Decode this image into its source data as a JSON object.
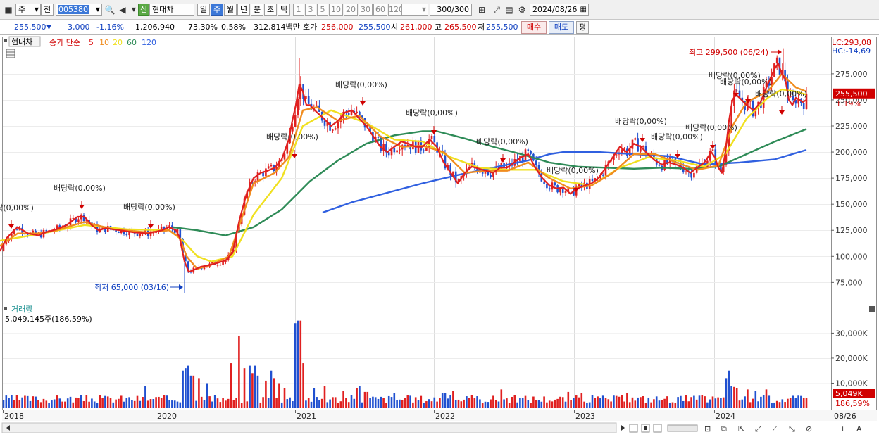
{
  "toolbar": {
    "period_type": "주",
    "market": "전",
    "code": "005380",
    "badge": "신",
    "name": "현대차",
    "periods": [
      "일",
      "주",
      "월",
      "년",
      "분",
      "초",
      "틱"
    ],
    "selected_period": "주",
    "intervals": [
      "1",
      "3",
      "5",
      "10",
      "20",
      "30",
      "60",
      "120"
    ],
    "count": "300",
    "count_total": "/300",
    "date": "2024/08/26"
  },
  "quote": {
    "price": "255,500",
    "change": "3,000",
    "change_pct": "-1.16%",
    "volume": "1,206,940",
    "ratio": "73.30%",
    "turnover": "0.58%",
    "amount": "312,814백만",
    "hoga_label": "호가",
    "ask": "256,000",
    "bid": "255,500",
    "open_label": "시",
    "open": "261,000",
    "high_label": "고",
    "high": "265,500",
    "low_label": "저",
    "low": "255,500",
    "buy": "매수",
    "sell": "매도",
    "eval": "평"
  },
  "colors": {
    "ma5": "#e02020",
    "ma10": "#f08c1e",
    "ma20": "#f0e020",
    "ma60": "#2e8b57",
    "ma120": "#3060e0",
    "up": "#e02020",
    "down": "#2050d0"
  },
  "chart_data": {
    "type": "line",
    "title": "현대차",
    "legend": {
      "label": "종가 단순",
      "periods": [
        "5",
        "10",
        "20",
        "60",
        "120"
      ]
    },
    "y_ticks": [
      "275,000",
      "250,000",
      "225,000",
      "200,000",
      "175,000",
      "150,000",
      "125,000",
      "100,000",
      "75,000"
    ],
    "ylim": [
      55000,
      310000
    ],
    "x_labels": [
      "2018",
      "2020",
      "2021",
      "2022",
      "2023",
      "2024",
      "08/26"
    ],
    "lc_label": "LC:293,08",
    "hc_label": "HC:-14,69",
    "last_price_label": "255,500",
    "last_pct_label": "1.19%",
    "high_annotation": "최고 299,500 (06/24)",
    "low_annotation": "최저 65,000 (03/16)",
    "dividend_label": "배당락(0,00%)",
    "series": [
      {
        "name": "5",
        "x": [
          0,
          10,
          20,
          25,
          40,
          55,
          60,
          70,
          80,
          95,
          110,
          120,
          130,
          140,
          150,
          170,
          190,
          210,
          230,
          240,
          250,
          255,
          258,
          262,
          268,
          275,
          285,
          300,
          320,
          330,
          340,
          350,
          360,
          370,
          380,
          390,
          400,
          410,
          415,
          420,
          425,
          430,
          435,
          440,
          450,
          460,
          470,
          480,
          490,
          500,
          510,
          520,
          530,
          540,
          550,
          560,
          570,
          580,
          590,
          600,
          610,
          620,
          630,
          640,
          650,
          660,
          670,
          680,
          690,
          700,
          710,
          720,
          730,
          740,
          750,
          760,
          770,
          780,
          790,
          800,
          810,
          815,
          820,
          830,
          840,
          850,
          860,
          870,
          880,
          890,
          900,
          910,
          920,
          930,
          940,
          950,
          960,
          970,
          980,
          990,
          1000,
          1010,
          1015,
          1020,
          1025,
          1030,
          1035,
          1040,
          1045,
          1050,
          1060,
          1070,
          1080,
          1090,
          1100,
          1105,
          1110,
          1115,
          1120,
          1125,
          1130,
          1135,
          1140,
          1145
        ],
        "values": [
          105000,
          118000,
          125000,
          128000,
          122000,
          120000,
          122000,
          124000,
          126000,
          130000,
          138000,
          138000,
          130000,
          125000,
          127000,
          125000,
          123000,
          122000,
          125000,
          128000,
          125000,
          118000,
          108000,
          95000,
          85000,
          87000,
          90000,
          92000,
          96000,
          103000,
          135000,
          160000,
          175000,
          180000,
          182000,
          185000,
          193000,
          212000,
          230000,
          245000,
          265000,
          258000,
          245000,
          245000,
          238000,
          232000,
          225000,
          230000,
          238000,
          240000,
          232000,
          225000,
          215000,
          205000,
          200000,
          205000,
          210000,
          208000,
          205000,
          205000,
          212000,
          205000,
          190000,
          180000,
          170000,
          180000,
          186000,
          184000,
          182000,
          180000,
          185000,
          185000,
          190000,
          195000,
          198000,
          185000,
          175000,
          168000,
          165000,
          166000,
          160000,
          163000,
          165000,
          168000,
          170000,
          175000,
          185000,
          195000,
          205000,
          200000,
          208000,
          205000,
          198000,
          192000,
          188000,
          190000,
          188000,
          185000,
          180000,
          185000,
          190000,
          200000,
          195000,
          185000,
          180000,
          200000,
          230000,
          250000,
          255000,
          252000,
          245000,
          240000,
          248000,
          265000,
          280000,
          285000,
          275000,
          270000,
          250000,
          245000,
          252000,
          250000,
          248000,
          250000
        ]
      },
      {
        "name": "10",
        "x": [
          0,
          25,
          55,
          80,
          120,
          160,
          210,
          240,
          255,
          265,
          280,
          300,
          325,
          340,
          360,
          390,
          410,
          430,
          450,
          480,
          510,
          540,
          570,
          600,
          630,
          660,
          690,
          720,
          750,
          780,
          810,
          840,
          870,
          900,
          930,
          960,
          990,
          1020,
          1040,
          1060,
          1090,
          1110,
          1130,
          1145
        ],
        "values": [
          110000,
          122000,
          122000,
          125000,
          133000,
          126000,
          123000,
          125000,
          118000,
          100000,
          88000,
          92000,
          100000,
          130000,
          170000,
          180000,
          195000,
          240000,
          243000,
          230000,
          235000,
          215000,
          205000,
          206000,
          200000,
          180000,
          182000,
          182000,
          190000,
          175000,
          165000,
          168000,
          180000,
          198000,
          198000,
          190000,
          183000,
          187000,
          225000,
          248000,
          258000,
          275000,
          262000,
          258000
        ]
      },
      {
        "name": "20",
        "x": [
          0,
          60,
          120,
          180,
          240,
          260,
          280,
          300,
          330,
          360,
          400,
          430,
          470,
          520,
          560,
          600,
          640,
          680,
          720,
          760,
          800,
          840,
          880,
          920,
          960,
          1000,
          1030,
          1060,
          1090,
          1110,
          1130,
          1145
        ],
        "values": [
          115000,
          122000,
          130000,
          126000,
          125000,
          115000,
          100000,
          95000,
          100000,
          140000,
          175000,
          225000,
          240000,
          228000,
          212000,
          210000,
          195000,
          185000,
          183000,
          183000,
          172000,
          168000,
          185000,
          195000,
          192000,
          186000,
          198000,
          232000,
          252000,
          260000,
          258000,
          255000
        ]
      },
      {
        "name": "60",
        "x": [
          245,
          280,
          320,
          360,
          400,
          440,
          480,
          520,
          560,
          600,
          620,
          660,
          700,
          740,
          780,
          820,
          860,
          900,
          940,
          980,
          1020,
          1060,
          1100,
          1145
        ],
        "values": [
          128000,
          125000,
          120000,
          128000,
          145000,
          172000,
          192000,
          208000,
          216000,
          220000,
          220000,
          213000,
          205000,
          198000,
          190000,
          186000,
          185000,
          184000,
          185000,
          184000,
          186000,
          198000,
          210000,
          222000
        ]
      },
      {
        "name": "120",
        "x": [
          458,
          500,
          550,
          600,
          650,
          700,
          750,
          780,
          800,
          850,
          900,
          950,
          1000,
          1050,
          1100,
          1145
        ],
        "values": [
          142000,
          152000,
          161000,
          170000,
          178000,
          185000,
          192000,
          198000,
          200000,
          200000,
          198000,
          196000,
          188000,
          190000,
          193000,
          202000
        ]
      }
    ],
    "volume_panel": {
      "label": "거래량",
      "value_label": "5,049,145주(186,59%)",
      "y_ticks": [
        "30,000K",
        "20,000K",
        "10,000K"
      ],
      "last_label": "5,049K",
      "last_pct": "186,59%",
      "spikes_x": [
        206,
        258,
        263,
        268,
        273,
        282,
        294,
        327,
        341,
        348,
        354,
        358,
        362,
        367,
        378,
        384,
        390,
        397,
        403,
        421,
        425,
        430,
        446,
        460,
        488,
        506,
        512,
        520,
        560,
        630,
        642,
        712,
        807,
        826,
        890,
        1030,
        1034,
        1038,
        1042,
        1046,
        1062,
        1072,
        1088
      ],
      "spikes_v": [
        9000,
        15000,
        16000,
        17000,
        13000,
        12000,
        10000,
        18000,
        29000,
        16000,
        17000,
        14000,
        17000,
        13000,
        11000,
        15000,
        12000,
        10000,
        8000,
        34000,
        35000,
        18000,
        8000,
        9000,
        7000,
        8000,
        9000,
        6500,
        6000,
        6000,
        7000,
        7500,
        6500,
        6000,
        6000,
        12000,
        15000,
        9000,
        8500,
        8000,
        7500,
        7000,
        7500
      ],
      "base_v": 3500,
      "ylim": [
        0,
        38000
      ]
    }
  }
}
